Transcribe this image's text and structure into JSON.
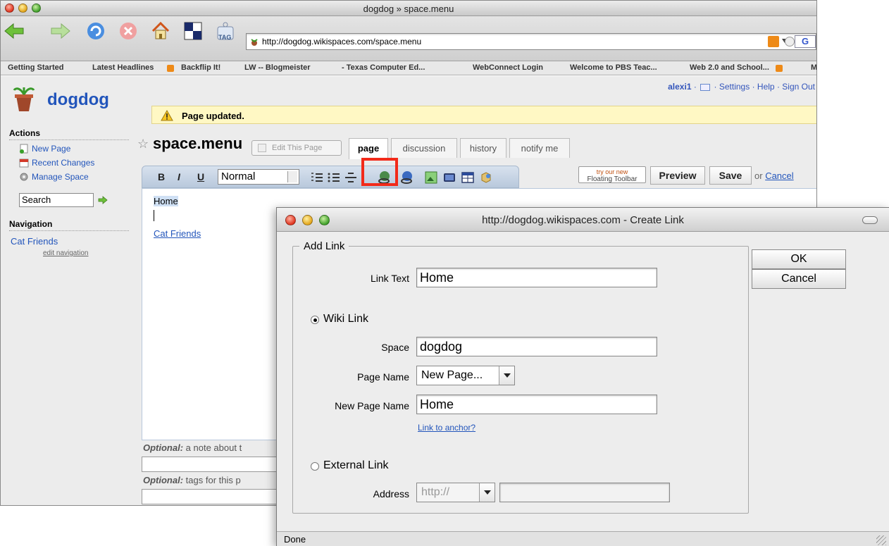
{
  "browser": {
    "window_title": "dogdog » space.menu",
    "url": "http://dogdog.wikispaces.com/space.menu",
    "tag_label": "TAG",
    "search_engine_letter": "G",
    "bookmarks": [
      "Getting Started",
      "Latest Headlines",
      "Backflip It!",
      "LW -- Blogmeister",
      "- Texas Computer Ed...",
      "WebConnect Login",
      "Welcome to PBS Teac...",
      "Web 2.0 and School...",
      "M"
    ]
  },
  "site": {
    "name": "dogdog",
    "username": "alexi1",
    "links": [
      "Settings",
      "Help",
      "Sign Out"
    ],
    "separator": "·",
    "notice": "Page updated."
  },
  "sidebar": {
    "actions_heading": "Actions",
    "actions": [
      "New Page",
      "Recent Changes",
      "Manage Space"
    ],
    "search_value": "Search",
    "navigation_heading": "Navigation",
    "nav_items": [
      "Cat Friends"
    ],
    "edit_navigation": "edit navigation"
  },
  "page": {
    "title": "space.menu",
    "edit_button": "Edit This Page",
    "tabs": [
      "page",
      "discussion",
      "history",
      "notify me"
    ],
    "active_tab": "page"
  },
  "editor": {
    "bold": "B",
    "italic": "I",
    "underline": "U",
    "format_value": "Normal",
    "floating_toolbar_top": "try our new",
    "floating_toolbar_bottom": "Floating Toolbar",
    "preview": "Preview",
    "save": "Save",
    "or_text": "or",
    "cancel": "Cancel",
    "content": {
      "line1": "Home",
      "link": "Cat Friends"
    },
    "optional_label": "Optional:",
    "note_text": "a note about t",
    "tags_text": "tags for this p"
  },
  "dialog": {
    "title": "http://dogdog.wikispaces.com - Create Link",
    "legend": "Add Link",
    "link_text_label": "Link Text",
    "link_text_value": "Home",
    "wiki_link_label": "Wiki Link",
    "space_label": "Space",
    "space_value": "dogdog",
    "page_name_label": "Page Name",
    "page_name_value": "New Page...",
    "new_page_name_label": "New Page Name",
    "new_page_name_value": "Home",
    "anchor_link": "Link to anchor?",
    "external_link_label": "External Link",
    "address_label": "Address",
    "address_protocol": "http://",
    "address_value": "",
    "ok": "OK",
    "cancel": "Cancel",
    "wiki_link_selected": true,
    "status": "Done"
  },
  "colors": {
    "link": "#2255bb",
    "highlight": "#f22a1a",
    "notice_bg": "#fff8c4"
  }
}
